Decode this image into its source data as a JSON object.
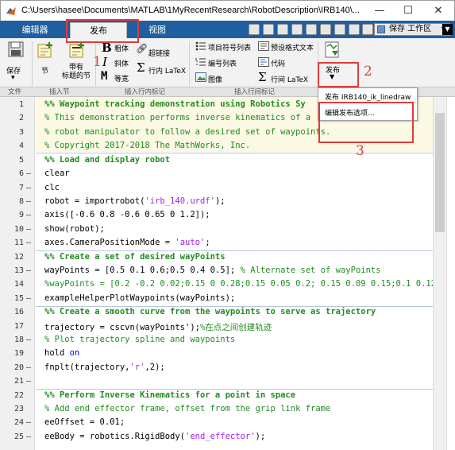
{
  "window": {
    "title": "C:\\Users\\hasee\\Documents\\MATLAB\\1MyRecentResearch\\RobotDescription\\IRB140\\...",
    "minimize": "—",
    "maximize": "☐",
    "close": "✕"
  },
  "tabs": [
    {
      "label": "编辑器"
    },
    {
      "label": "发布"
    },
    {
      "label": "视图"
    }
  ],
  "workspace_label": "保存 工作区",
  "toolbar": {
    "save_label": "保存",
    "section_label": "节",
    "section_with_title_label": "带有\n标题的节",
    "bold_label": "粗体",
    "italic_label": "斜体",
    "mono_label": "等宽",
    "hyperlink_label": "超链接",
    "inline_latex_label": "行内 LaTeX",
    "bullet_list_label": "项目符号列表",
    "numbered_list_label": "编号列表",
    "image_label": "图像",
    "preformatted_label": "预设格式文本",
    "code_label": "代码",
    "display_latex_label": "行间 LaTeX",
    "publish_label": "发布"
  },
  "sections": {
    "file": "文件",
    "insert_section": "插入节",
    "insert_inline": "插入行内标记",
    "insert_block": "插入行间标记"
  },
  "menu": {
    "item1": "发布 IRB140_ik_linedraw",
    "item2": "编辑发布选项..."
  },
  "annotations": {
    "n1": "1",
    "n2": "2",
    "n3": "3"
  },
  "code_lines": [
    {
      "n": "1",
      "dash": "",
      "text": "%% Waypoint tracking demonstration using Robotics Sy"
    },
    {
      "n": "2",
      "dash": "",
      "text": "% This demonstration performs inverse kinematics of a"
    },
    {
      "n": "3",
      "dash": "",
      "text": "% robot manipulator to follow a desired set of waypoints."
    },
    {
      "n": "4",
      "dash": "",
      "text": "% Copyright 2017-2018 The MathWorks, Inc."
    },
    {
      "n": "5",
      "dash": "",
      "text": "%% Load and display robot"
    },
    {
      "n": "6",
      "dash": "—",
      "text": "clear"
    },
    {
      "n": "7",
      "dash": "—",
      "text": "clc"
    },
    {
      "n": "8",
      "dash": "—",
      "text": "robot = importrobot('irb_140.urdf');"
    },
    {
      "n": "9",
      "dash": "—",
      "text": "axis([-0.6 0.8 -0.6 0.65 0 1.2]);"
    },
    {
      "n": "10",
      "dash": "—",
      "text": "show(robot);"
    },
    {
      "n": "11",
      "dash": "—",
      "text": "axes.CameraPositionMode = 'auto';"
    },
    {
      "n": "12",
      "dash": "",
      "text": "%% Create a set of desired wayPoints"
    },
    {
      "n": "13",
      "dash": "—",
      "text": "wayPoints = [0.5 0.1 0.6;0.5 0.4 0.5]; % Alternate set of wayPoints"
    },
    {
      "n": "14",
      "dash": "",
      "text": "%wayPoints = [0.2 -0.2 0.02;0.15 0 0.28;0.15 0.05 0.2; 0.15 0.09 0.15;0.1 0.12 0."
    },
    {
      "n": "15",
      "dash": "—",
      "text": "exampleHelperPlotWaypoints(wayPoints);"
    },
    {
      "n": "16",
      "dash": "",
      "text": "%% Create a smooth curve from the waypoints to serve as trajectory"
    },
    {
      "n": "17",
      "dash": "—",
      "text": "trajectory = cscvn(wayPoints');%在点之间创建轨迹"
    },
    {
      "n": "18",
      "dash": "",
      "text": "% Plot trajectory spline and waypoints"
    },
    {
      "n": "19",
      "dash": "—",
      "text": "hold on"
    },
    {
      "n": "20",
      "dash": "—",
      "text": "fnplt(trajectory,'r',2);"
    },
    {
      "n": "21",
      "dash": "",
      "text": ""
    },
    {
      "n": "22",
      "dash": "",
      "text": "%% Perform Inverse Kinematics for a point in space"
    },
    {
      "n": "23",
      "dash": "",
      "text": "% Add end effector frame, offset from the grip link frame"
    },
    {
      "n": "24",
      "dash": "—",
      "text": "eeOffset = 0.01;"
    },
    {
      "n": "25",
      "dash": "—",
      "text": "eeBody = robotics.RigidBody('end_effector');"
    }
  ],
  "code_tokens": {
    "l8a": "robot = importrobot(",
    "l8s": "'irb_140.urdf'",
    "l8b": ");",
    "l11a": "axes.CameraPositionMode = ",
    "l11s": "'auto'",
    "l11b": ";",
    "l13a": "wayPoints = [0.5 0.1 0.6;0.5 0.4 0.5]; ",
    "l13c": "% Alternate set of wayPoints",
    "l17a": "trajectory = cscvn(wayPoints');",
    "l17c": "%在点之间创建轨迹",
    "l19a": "hold ",
    "l19k": "on",
    "l20a": "fnplt(trajectory,",
    "l20s": "'r'",
    "l20b": ",2);",
    "l25a": "eeBody = robotics.RigidBody(",
    "l25s": "'end_effector'",
    "l25b": ");"
  }
}
